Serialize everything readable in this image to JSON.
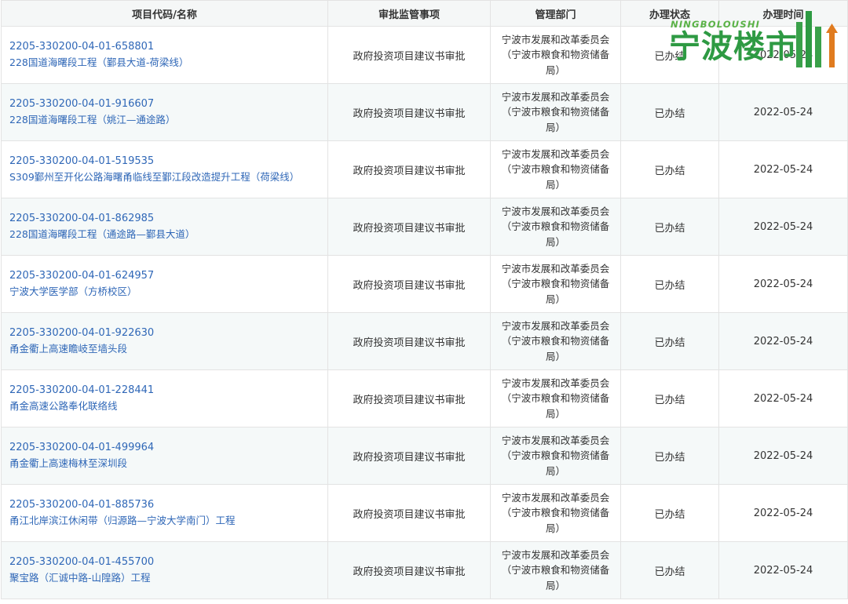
{
  "table": {
    "headers": [
      "项目代码/名称",
      "审批监管事项",
      "管理部门",
      "办理状态",
      "办理时间"
    ],
    "rows": [
      {
        "code": "2205-330200-04-01-658801",
        "name": "228国道海曙段工程（鄞县大道-荷梁线）",
        "item": "政府投资项目建议书审批",
        "dept": "宁波市发展和改革委员会（宁波市粮食和物资储备局）",
        "status": "已办结",
        "date": "2022-05-24"
      },
      {
        "code": "2205-330200-04-01-916607",
        "name": "228国道海曙段工程（姚江—通途路）",
        "item": "政府投资项目建议书审批",
        "dept": "宁波市发展和改革委员会（宁波市粮食和物资储备局）",
        "status": "已办结",
        "date": "2022-05-24"
      },
      {
        "code": "2205-330200-04-01-519535",
        "name": "S309鄞州至开化公路海曙甬临线至鄞江段改造提升工程（荷梁线）",
        "item": "政府投资项目建议书审批",
        "dept": "宁波市发展和改革委员会（宁波市粮食和物资储备局）",
        "status": "已办结",
        "date": "2022-05-24"
      },
      {
        "code": "2205-330200-04-01-862985",
        "name": "228国道海曙段工程（通途路—鄞县大道）",
        "item": "政府投资项目建议书审批",
        "dept": "宁波市发展和改革委员会（宁波市粮食和物资储备局）",
        "status": "已办结",
        "date": "2022-05-24"
      },
      {
        "code": "2205-330200-04-01-624957",
        "name": "宁波大学医学部（方桥校区）",
        "item": "政府投资项目建议书审批",
        "dept": "宁波市发展和改革委员会（宁波市粮食和物资储备局）",
        "status": "已办结",
        "date": "2022-05-24"
      },
      {
        "code": "2205-330200-04-01-922630",
        "name": "甬金衢上高速瞻岐至墙头段",
        "item": "政府投资项目建议书审批",
        "dept": "宁波市发展和改革委员会（宁波市粮食和物资储备局）",
        "status": "已办结",
        "date": "2022-05-24"
      },
      {
        "code": "2205-330200-04-01-228441",
        "name": "甬金高速公路奉化联络线",
        "item": "政府投资项目建议书审批",
        "dept": "宁波市发展和改革委员会（宁波市粮食和物资储备局）",
        "status": "已办结",
        "date": "2022-05-24"
      },
      {
        "code": "2205-330200-04-01-499964",
        "name": "甬金衢上高速梅林至深圳段",
        "item": "政府投资项目建议书审批",
        "dept": "宁波市发展和改革委员会（宁波市粮食和物资储备局）",
        "status": "已办结",
        "date": "2022-05-24"
      },
      {
        "code": "2205-330200-04-01-885736",
        "name": "甬江北岸滨江休闲带（归源路—宁波大学南门）工程",
        "item": "政府投资项目建议书审批",
        "dept": "宁波市发展和改革委员会（宁波市粮食和物资储备局）",
        "status": "已办结",
        "date": "2022-05-24"
      },
      {
        "code": "2205-330200-04-01-455700",
        "name": "聚宝路（汇诚中路-山隍路）工程",
        "item": "政府投资项目建议书审批",
        "dept": "宁波市发展和改革委员会（宁波市粮食和物资储备局）",
        "status": "已办结",
        "date": "2022-05-24"
      }
    ]
  },
  "watermark": {
    "small_text": "NINGBOLOUSHI",
    "big_text": "宁波楼市",
    "color": "#2e9a43"
  },
  "colors": {
    "link": "#2f67b7",
    "header_bg": "#f5f7f7",
    "alt_row_bg": "#f5f9f9",
    "border": "#e3e3e3"
  }
}
